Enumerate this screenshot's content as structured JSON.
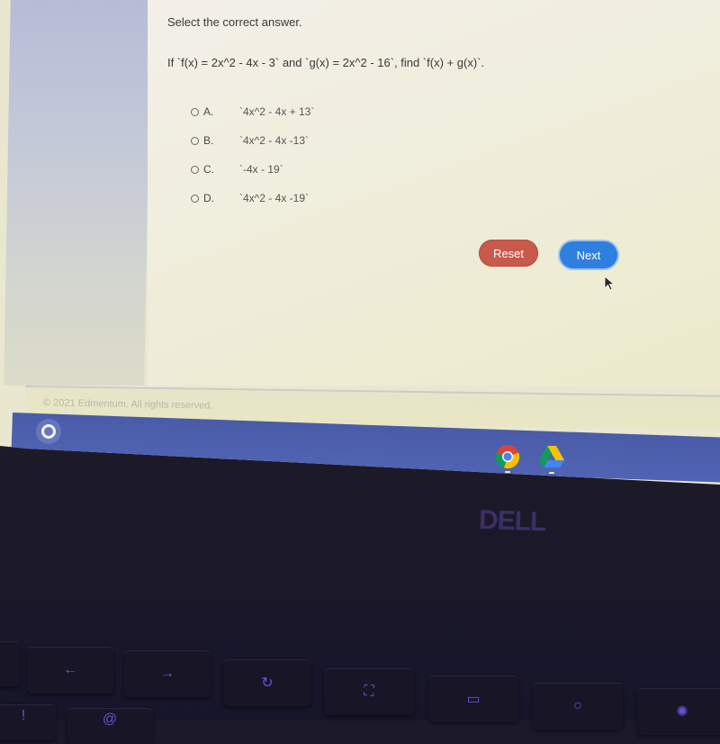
{
  "quiz": {
    "instruction": "Select the correct answer.",
    "question": "If `f(x) = 2x^2 - 4x - 3` and `g(x) = 2x^2 - 16`, find `f(x) + g(x)`.",
    "options": [
      {
        "letter": "A.",
        "text": "`4x^2 - 4x + 13`",
        "selected": false
      },
      {
        "letter": "B.",
        "text": "`4x^2 - 4x -13`",
        "selected": false
      },
      {
        "letter": "C.",
        "text": "`-4x - 19`",
        "selected": false
      },
      {
        "letter": "D.",
        "text": "`4x^2 - 4x -19`",
        "selected": false
      }
    ],
    "reset_label": "Reset",
    "next_label": "Next"
  },
  "footer": {
    "copyright": "© 2021 Edmentum. All rights reserved."
  },
  "shelf": {
    "apps": [
      {
        "name": "Chrome",
        "icon": "chrome-icon"
      },
      {
        "name": "Google Drive",
        "icon": "google-drive-icon"
      }
    ]
  },
  "device": {
    "brand": "DELL"
  },
  "keyboard": {
    "keys": [
      {
        "icon": "back-arrow-icon",
        "glyph": "←"
      },
      {
        "icon": "forward-arrow-icon",
        "glyph": "→"
      },
      {
        "icon": "refresh-icon",
        "glyph": "↻"
      },
      {
        "icon": "fullscreen-icon",
        "glyph": "⛶"
      },
      {
        "icon": "overview-icon",
        "glyph": "▭"
      },
      {
        "icon": "brightness-down-icon",
        "glyph": "○"
      },
      {
        "icon": "brightness-up-icon",
        "glyph": "✺"
      }
    ],
    "lower_keys": [
      "!",
      "@"
    ]
  },
  "colors": {
    "reset": "#c95a4b",
    "next": "#2f7fe0",
    "shelf": "#4d60ae",
    "content_bg": "#f0eedd"
  }
}
